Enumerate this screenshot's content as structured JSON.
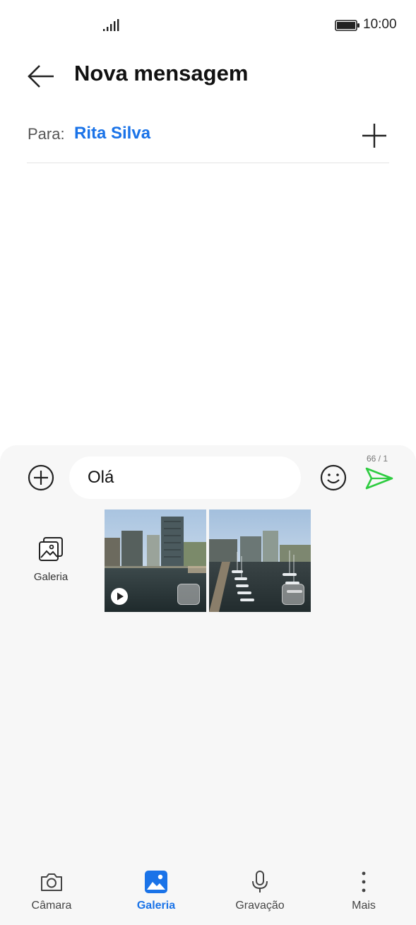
{
  "status_bar": {
    "time": "10:00"
  },
  "header": {
    "title": "Nova mensagem"
  },
  "recipient": {
    "label": "Para:",
    "name": "Rita Silva"
  },
  "composer": {
    "text": "Olá",
    "counter": "66 / 1"
  },
  "attachments": {
    "gallery_label": "Galeria",
    "thumbnails": [
      {
        "type": "video"
      },
      {
        "type": "image"
      }
    ]
  },
  "bottom_nav": {
    "items": [
      {
        "label": "Câmara",
        "icon": "camera-icon"
      },
      {
        "label": "Galeria",
        "icon": "gallery-icon",
        "active": true
      },
      {
        "label": "Gravação",
        "icon": "microphone-icon"
      },
      {
        "label": "Mais",
        "icon": "more-vertical-icon"
      }
    ]
  },
  "colors": {
    "accent": "#1a73e8",
    "send": "#2ecc40",
    "panel": "#f7f7f7"
  }
}
